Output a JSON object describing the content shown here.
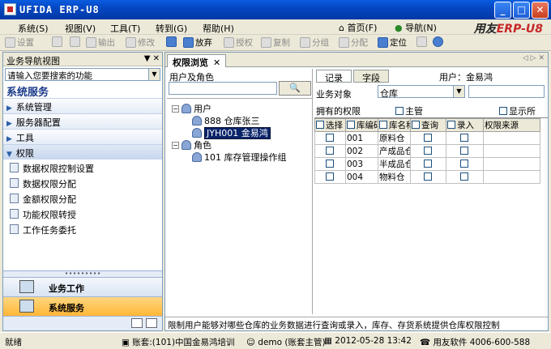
{
  "window": {
    "title": "UFIDA ERP-U8",
    "min": "_",
    "max": "□",
    "close": "✕"
  },
  "menu": {
    "items": [
      "系统(S)",
      "视图(V)",
      "工具(T)",
      "转到(G)",
      "帮助(H)"
    ],
    "home": "首页(F)",
    "nav": "导航(N)",
    "brand_prefix": "用友",
    "brand_suffix": "ERP-U8"
  },
  "toolbar": {
    "setup": "设置",
    "print": "",
    "preview": "",
    "output": "输出",
    "modify": "修改",
    "save": "",
    "abandon": "放弃",
    "authorize": "授权",
    "copy": "复制",
    "group": "分组",
    "assign": "分配",
    "locate": "定位"
  },
  "leftnav": {
    "header": "业务导航视图",
    "header_icons": "▼ ✕",
    "search_placeholder": "请输入您要搜索的功能",
    "section_title": "系统服务",
    "groups": [
      "系统管理",
      "服务器配置",
      "工具",
      "权限"
    ],
    "sub_items": [
      "数据权限控制设置",
      "数据权限分配",
      "金额权限分配",
      "功能权限转授",
      "工作任务委托"
    ],
    "grip": "∙∙∙∙∙∙∙∙∙",
    "bottom_tabs": [
      "业务工作",
      "系统服务"
    ]
  },
  "main": {
    "tab_label": "权限浏览",
    "tab_close": "✕",
    "tab_nav": "◁ ▷ ✕",
    "users_label": "用户及角色",
    "find_button": "🔍",
    "tree": {
      "users_node": "用户",
      "user1": "888 仓库张三",
      "user2": "JYH001 金易鸿",
      "roles_node": "角色",
      "role1": "101 库存管理操作组"
    },
    "tabs": [
      "记录",
      "字段"
    ],
    "user_label": "用户：金易鸿",
    "biz_object_label": "业务对象",
    "biz_object_value": "仓库",
    "owned_label": "拥有的权限",
    "supervisor_label": "主管",
    "show_all_label": "显示所",
    "grid_headers": [
      "选择",
      "库编码",
      "库名称",
      "查询",
      "录入",
      "权限来源"
    ],
    "rows": [
      [
        "001",
        "原料仓"
      ],
      [
        "002",
        "产成品仓"
      ],
      [
        "003",
        "半成品仓"
      ],
      [
        "004",
        "物料仓"
      ]
    ],
    "description": "限制用户能够对哪些仓库的业务数据进行查询或录入，库存、存货系统提供仓库权限控制"
  },
  "status": {
    "ready": "就绪",
    "account": "账套:(101)中国金易鸿培训",
    "user": "demo (账套主管)",
    "date": "2012-05-28 13:42",
    "vendor": "用友软件 4006-600-588"
  }
}
